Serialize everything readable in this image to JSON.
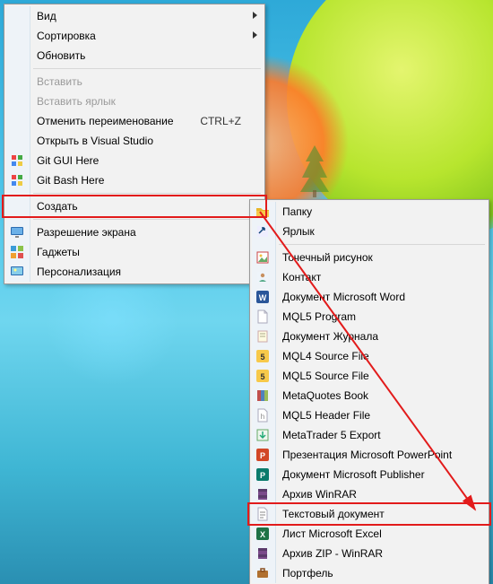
{
  "menu1": {
    "items": [
      {
        "label": "Вид",
        "submenu": true,
        "icon": null
      },
      {
        "label": "Сортировка",
        "submenu": true,
        "icon": null
      },
      {
        "label": "Обновить",
        "icon": null
      },
      {
        "sep": true
      },
      {
        "label": "Вставить",
        "disabled": true,
        "icon": null
      },
      {
        "label": "Вставить ярлык",
        "disabled": true,
        "icon": null
      },
      {
        "label": "Отменить переименование",
        "shortcut": "CTRL+Z",
        "icon": null
      },
      {
        "label": "Открыть в Visual Studio",
        "icon": null
      },
      {
        "label": "Git GUI Here",
        "icon": "git"
      },
      {
        "label": "Git Bash Here",
        "icon": "git"
      },
      {
        "sep": true
      },
      {
        "label": "Создать",
        "submenu": true,
        "highlighted": true,
        "icon": null
      },
      {
        "sep": true
      },
      {
        "label": "Разрешение экрана",
        "icon": "screen"
      },
      {
        "label": "Гаджеты",
        "icon": "gadgets"
      },
      {
        "label": "Персонализация",
        "icon": "personalize"
      }
    ]
  },
  "menu2": {
    "items": [
      {
        "label": "Папку",
        "icon": "folder"
      },
      {
        "label": "Ярлык",
        "icon": "shortcut"
      },
      {
        "sep": true
      },
      {
        "label": "Точечный рисунок",
        "icon": "bmp"
      },
      {
        "label": "Контакт",
        "icon": "contact"
      },
      {
        "label": "Документ Microsoft Word",
        "icon": "word"
      },
      {
        "label": "MQL5 Program",
        "icon": "file"
      },
      {
        "label": "Документ Журнала",
        "icon": "journal"
      },
      {
        "label": "MQL4 Source File",
        "icon": "mql"
      },
      {
        "label": "MQL5 Source File",
        "icon": "mql"
      },
      {
        "label": "MetaQuotes Book",
        "icon": "book"
      },
      {
        "label": "MQL5 Header File",
        "icon": "header"
      },
      {
        "label": "MetaTrader 5 Export",
        "icon": "export"
      },
      {
        "label": "Презентация Microsoft PowerPoint",
        "icon": "ppt"
      },
      {
        "label": "Документ Microsoft Publisher",
        "icon": "pub"
      },
      {
        "label": "Архив WinRAR",
        "icon": "rar"
      },
      {
        "label": "Текстовый документ",
        "icon": "txt",
        "highlighted": true
      },
      {
        "label": "Лист Microsoft Excel",
        "icon": "xls"
      },
      {
        "label": "Архив ZIP - WinRAR",
        "icon": "rar"
      },
      {
        "label": "Портфель",
        "icon": "briefcase"
      }
    ]
  },
  "annotations": {
    "highlight_create": true,
    "highlight_txt": true,
    "arrow_from_to": true
  }
}
